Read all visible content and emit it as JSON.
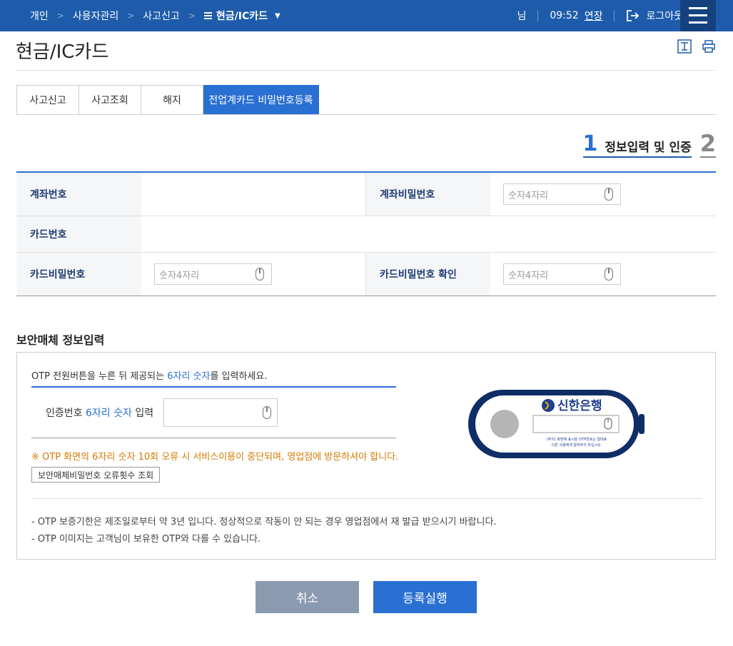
{
  "nav": {
    "crumbs": [
      "개인",
      "사용자관리",
      "사고신고"
    ],
    "current": "현금/IC카드",
    "user_suffix": "님",
    "time": "09:52",
    "extend": "연장",
    "logout": "로그아웃"
  },
  "page_title": "현금/IC카드",
  "tabs": [
    {
      "label": "사고신고",
      "active": false
    },
    {
      "label": "사고조회",
      "active": false
    },
    {
      "label": "해지",
      "active": false
    },
    {
      "label": "전업계카드 비밀번호등록",
      "active": true
    }
  ],
  "steps": {
    "current_num": "1",
    "current_label": "정보입력 및 인증",
    "next_num": "2"
  },
  "form": {
    "account_number_label": "계좌번호",
    "account_number_value": "",
    "account_password_label": "계좌비밀번호",
    "account_password_placeholder": "숫자4자리",
    "card_number_label": "카드번호",
    "card_number_value": "",
    "card_password_label": "카드비밀번호",
    "card_password_placeholder": "숫자4자리",
    "card_password_confirm_label": "카드비밀번호 확인",
    "card_password_confirm_placeholder": "숫자4자리"
  },
  "otp": {
    "heading": "보안매체 정보입력",
    "guide_pre": "OTP 전원버튼을 누른 뒤 제공되는 ",
    "guide_em": "6자리 숫자",
    "guide_post": "를 입력하세요.",
    "input_pre": "인증번호 ",
    "input_em": "6자리 숫자",
    "input_post": " 입력",
    "warning": "※ OTP 화면의 6자리 숫자 10회 오류 시 서비스이용이 중단되며, 영업점에 방문하셔야 합니다.",
    "error_count_button": "보안매체비밀번호 오류횟수 조회",
    "notes": [
      "-  OTP 보증기한은 제조일로부터 약 3년 입니다. 정상적으로 작동이 안 되는 경우 영업점에서 재 발급 받으시기 바랍니다.",
      "-  OTP 이미지는 고객님이 보유한 OTP와 다를 수 있습니다."
    ],
    "device_brand": "신한은행",
    "device_notice_1": "(주의) 화면에 표시된 OTP번호는 절대로",
    "device_notice_2": "다른 사람에게 알려주지 마십시오."
  },
  "buttons": {
    "cancel": "취소",
    "submit": "등록실행"
  },
  "colors": {
    "primary": "#2a70d2",
    "nav": "#1e5cab",
    "warning": "#d47a00",
    "cancel": "#8a9bb1"
  }
}
